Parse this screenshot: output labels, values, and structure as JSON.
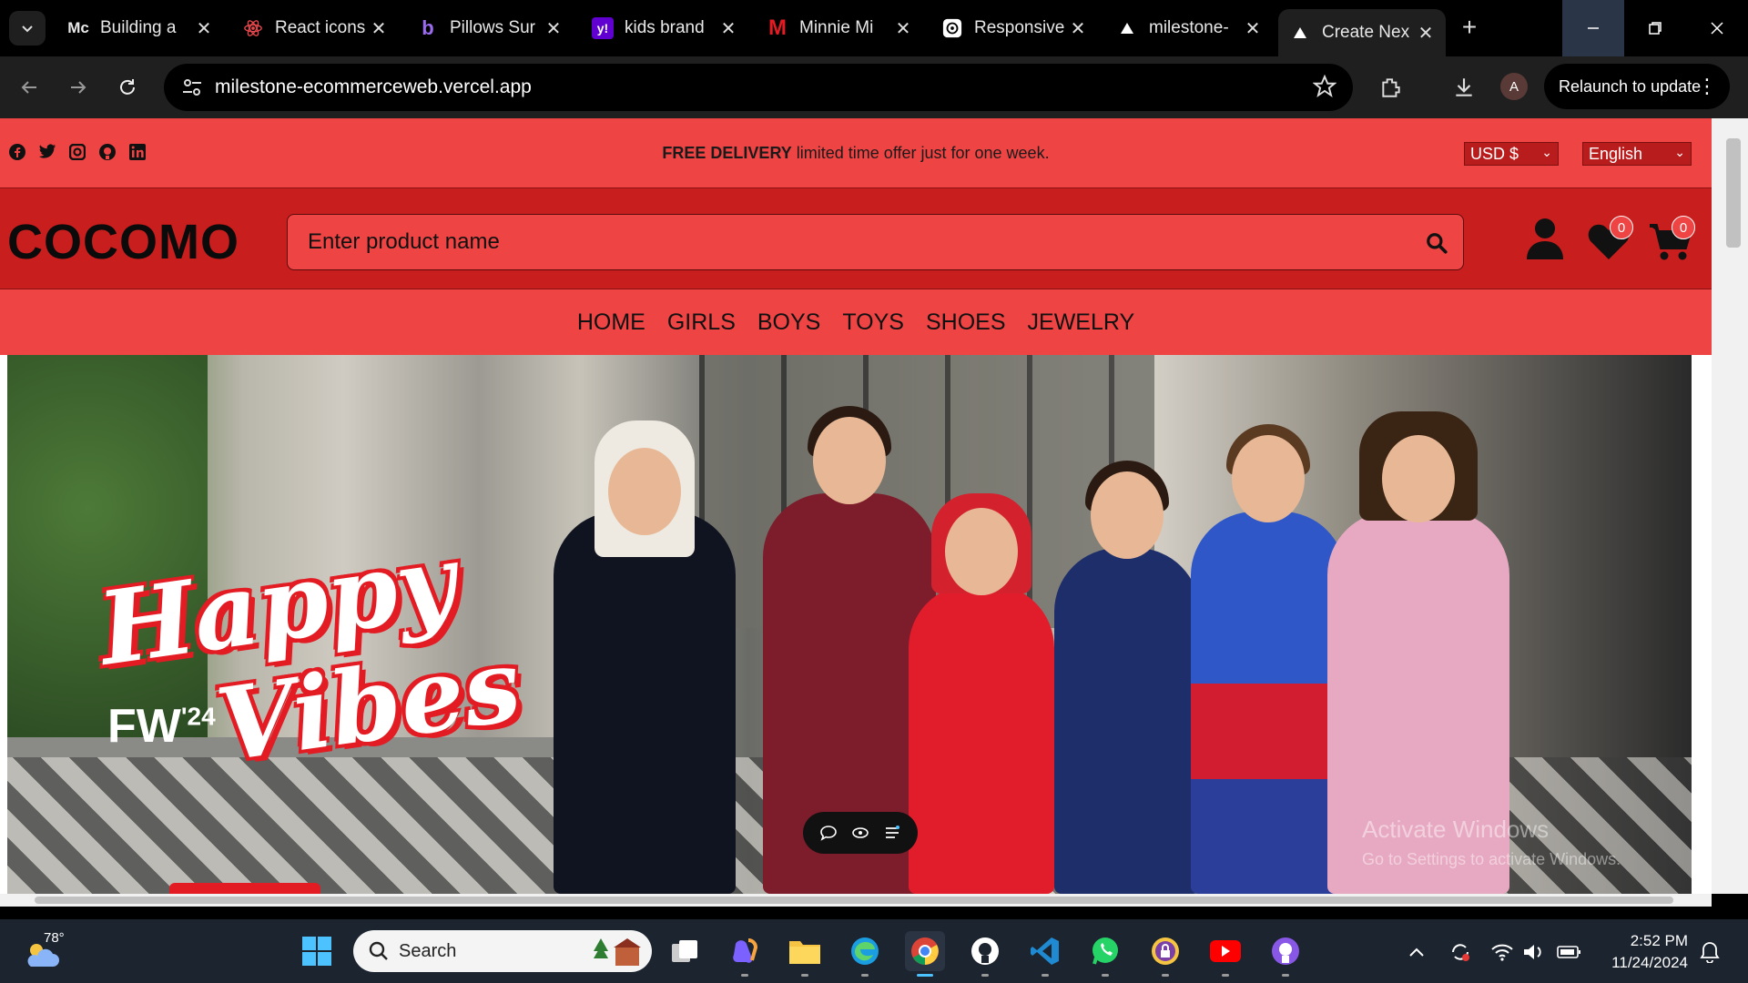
{
  "browser": {
    "tabs": [
      {
        "title": "Building a",
        "favicon": "Mc"
      },
      {
        "title": "React icons",
        "favicon": "react-logo"
      },
      {
        "title": "Pillows Sur",
        "favicon": "b"
      },
      {
        "title": "kids brand",
        "favicon": "y!"
      },
      {
        "title": "Minnie Mi",
        "favicon": "M"
      },
      {
        "title": "Responsive",
        "favicon": "openai-logo"
      },
      {
        "title": "milestone-",
        "favicon": "vercel-triangle"
      },
      {
        "title": "Create Nex",
        "favicon": "vercel-triangle"
      }
    ],
    "url": "milestone-ecommerceweb.vercel.app",
    "profile_initial": "A",
    "relaunch_label": "Relaunch to update"
  },
  "site": {
    "promo_bold": "FREE DELIVERY",
    "promo_rest": " limited time offer just for one week.",
    "currency": "USD $",
    "language": "English",
    "logo": "COCOMO",
    "search_placeholder": "Enter product name",
    "wishlist_count": "0",
    "cart_count": "0",
    "nav": [
      "HOME",
      "GIRLS",
      "BOYS",
      "TOYS",
      "SHOES",
      "JEWELRY"
    ],
    "hero": {
      "line1": "Happy",
      "line2": "Vibes",
      "season": "FW",
      "year": "'24"
    },
    "watermark_line1": "Activate Windows",
    "watermark_line2": "Go to Settings to activate Windows."
  },
  "taskbar": {
    "temperature": "78°",
    "search_label": "Search",
    "time": "2:52 PM",
    "date": "11/24/2024"
  },
  "colors": {
    "brand_red": "#ef4444",
    "header_red": "#c81e1e"
  }
}
